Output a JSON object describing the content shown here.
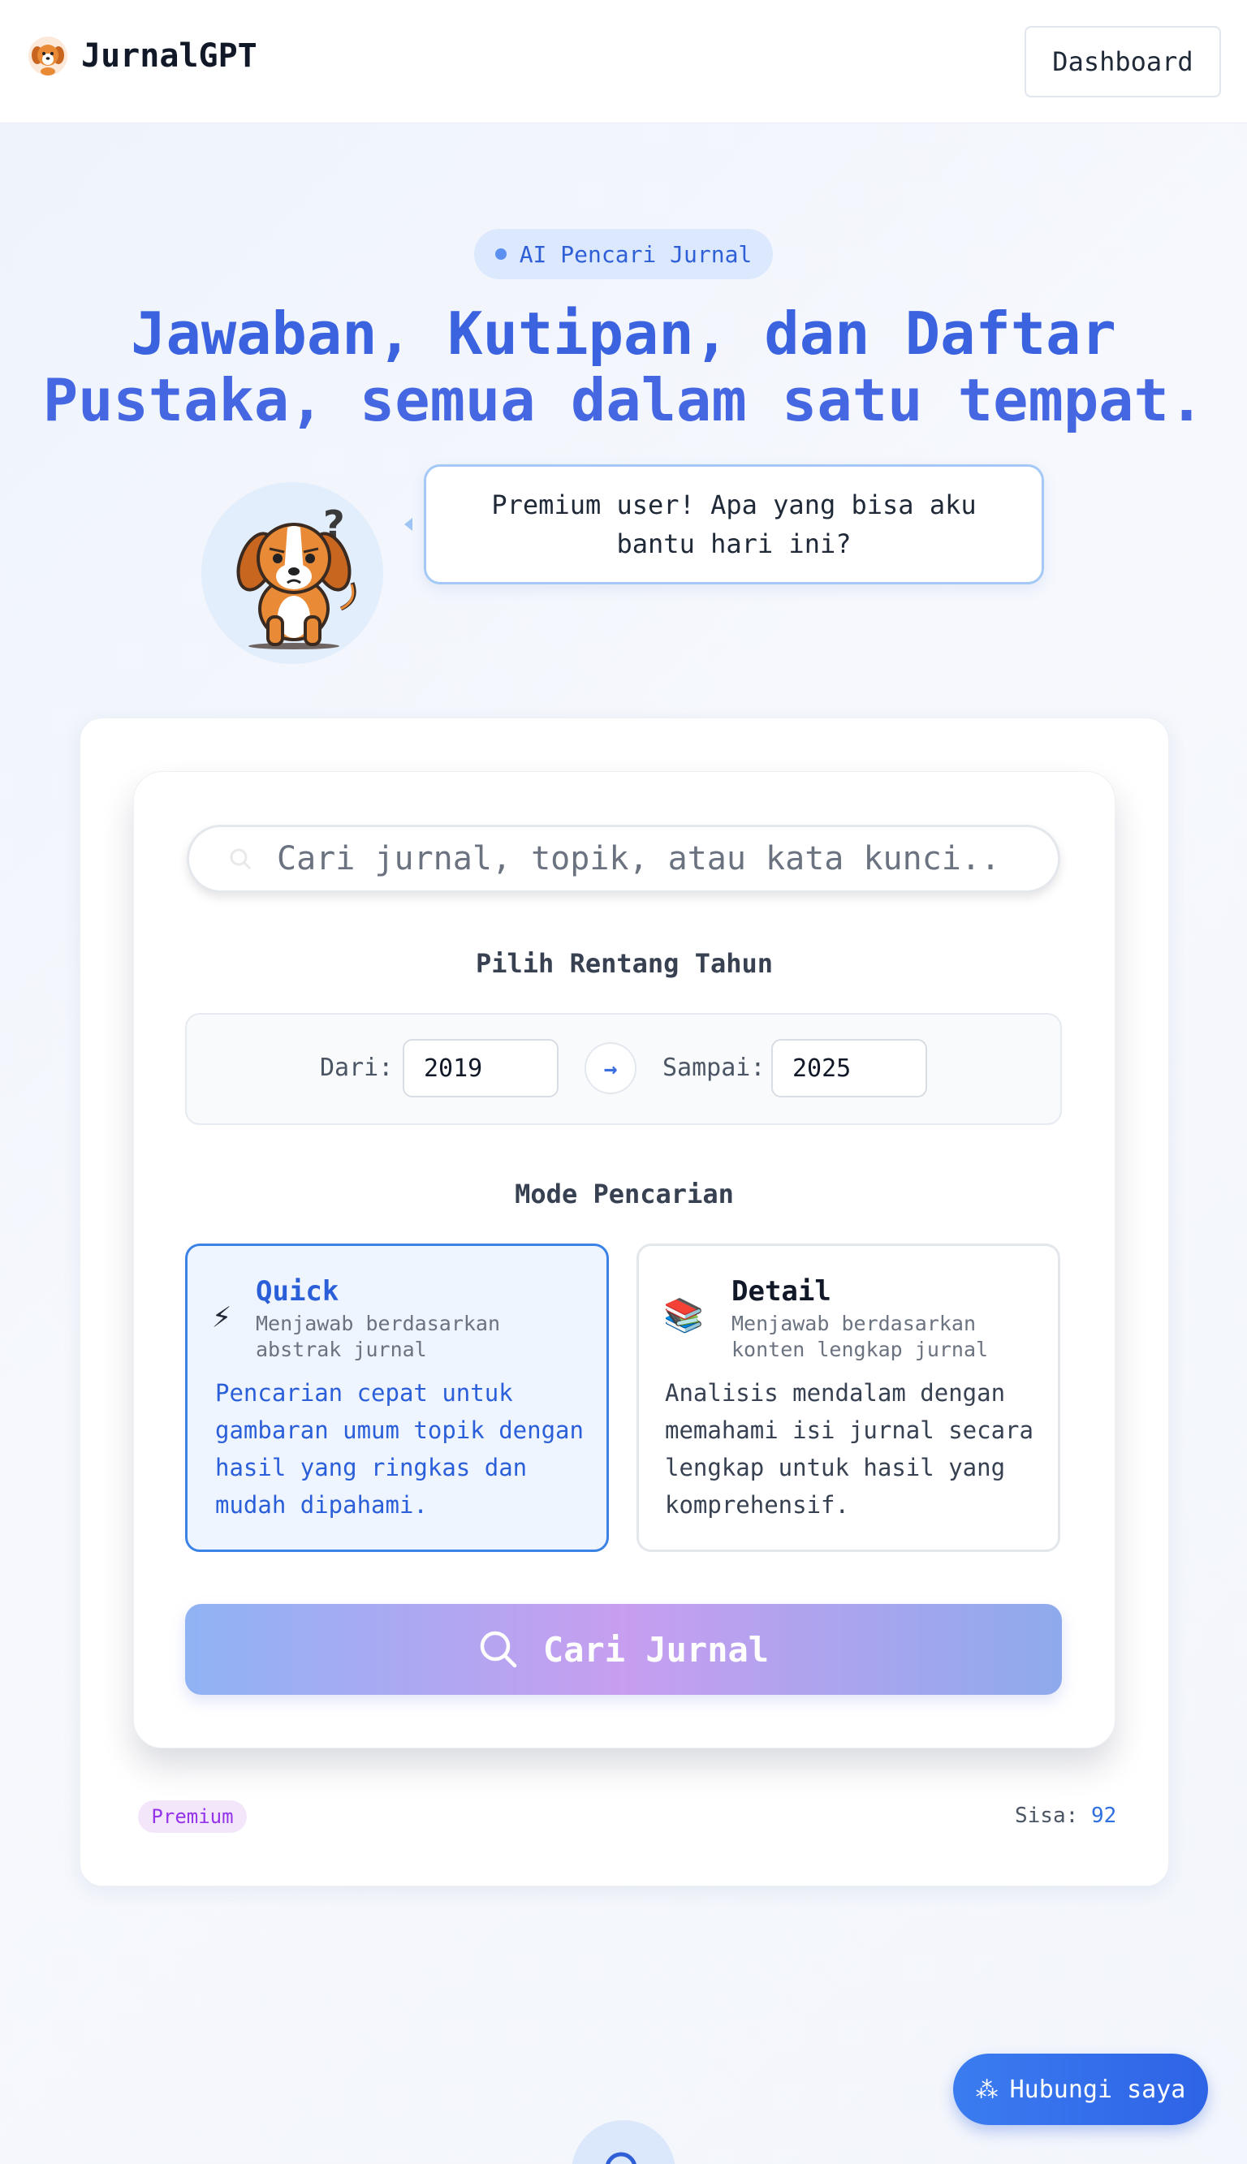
{
  "header": {
    "brand_name": "JurnalGPT",
    "logo_icon": "dog-logo-icon",
    "dashboard_label": "Dashboard"
  },
  "hero": {
    "pill_label": "AI Pencari Jurnal",
    "title_line1": "Jawaban, Kutipan, dan Daftar",
    "title_line2": "Pustaka, semua dalam satu tempat.",
    "mascot_icon": "confused-dog-icon",
    "bubble_text": "Premium user! Apa yang bisa aku bantu hari ini?"
  },
  "search": {
    "placeholder": "Cari jurnal, topik, atau kata kunci..",
    "value": ""
  },
  "year_range": {
    "heading": "Pilih Rentang Tahun",
    "from_label": "Dari:",
    "from_value": "2019",
    "to_label": "Sampai:",
    "to_value": "2025",
    "arrow": "→"
  },
  "mode": {
    "heading": "Mode Pencarian",
    "options": [
      {
        "icon": "⚡",
        "title": "Quick",
        "subtitle": "Menjawab berdasarkan abstrak jurnal",
        "description": "Pencarian cepat untuk gambaran umum topik dengan hasil yang ringkas dan mudah dipahami.",
        "selected": true
      },
      {
        "icon": "📚",
        "title": "Detail",
        "subtitle": "Menjawab berdasarkan konten lengkap jurnal",
        "description": "Analisis mendalam dengan memahami isi jurnal secara lengkap untuk hasil yang komprehensif.",
        "selected": false
      }
    ]
  },
  "submit": {
    "label": "Cari Jurnal"
  },
  "footer_card": {
    "badge": "Premium",
    "remaining_label": "Sisa:",
    "remaining_value": "92"
  },
  "contact": {
    "label": "Hubungi saya",
    "icon": "⁂"
  },
  "colors": {
    "accent": "#3b63e0",
    "selected_border": "#3b82e6",
    "badge_text": "#9333ea",
    "contact_bg": "#2e63e6"
  }
}
